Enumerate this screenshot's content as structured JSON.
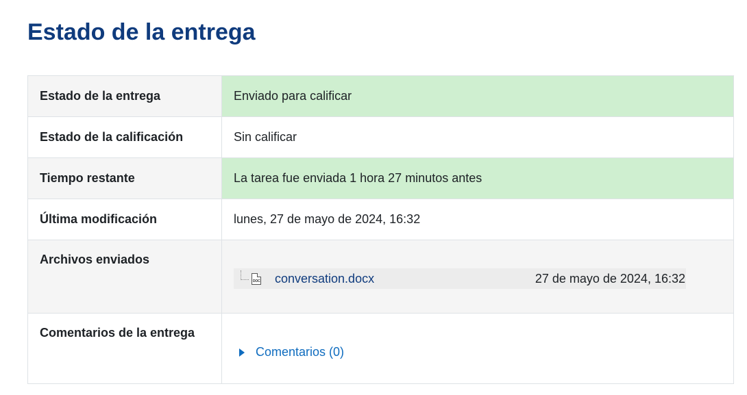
{
  "page_title": "Estado de la entrega",
  "rows": {
    "submission_status": {
      "label": "Estado de la entrega",
      "value": "Enviado para calificar"
    },
    "grading_status": {
      "label": "Estado de la calificación",
      "value": "Sin calificar"
    },
    "time_remaining": {
      "label": "Tiempo restante",
      "value": "La tarea fue enviada 1 hora 27 minutos antes"
    },
    "last_modified": {
      "label": "Última modificación",
      "value": "lunes, 27 de mayo de 2024, 16:32"
    },
    "submitted_files": {
      "label": "Archivos enviados",
      "files": [
        {
          "icon_label": "DOC",
          "name": "conversation.docx",
          "date": "27 de mayo de 2024, 16:32"
        }
      ]
    },
    "submission_comments": {
      "label": "Comentarios de la entrega",
      "toggle_label": "Comentarios (0)"
    }
  },
  "colors": {
    "title": "#0f3b7d",
    "success_bg": "#cfefd0",
    "link": "#0f6cbf",
    "header_bg": "#f5f5f5",
    "border": "#dee2e6"
  },
  "icons": {
    "file": "doc-file-icon",
    "toggle": "caret-right-icon"
  }
}
